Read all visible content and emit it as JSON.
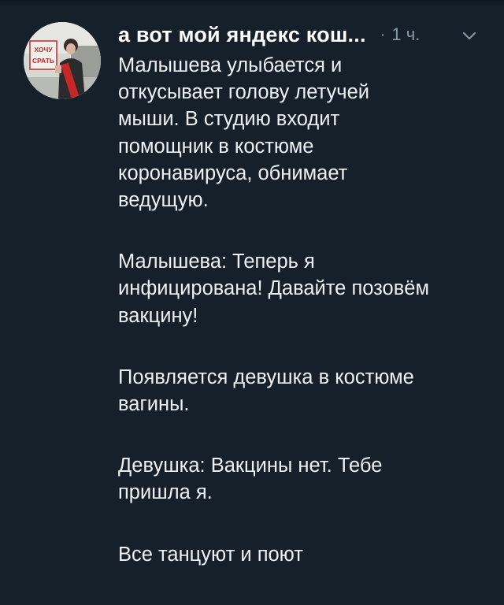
{
  "tweet": {
    "author": "а вот мой яндекс кош...",
    "separator": "·",
    "time": "1 ч.",
    "avatar_sign_text": "ХОЧУ СРАТЬ",
    "paragraphs": [
      "Малышева улыбается и откусывает голову летучей мыши. В студию входит помощник в костюме коронавируса, обнимает ведущую.",
      "Малышева: Теперь я инфицирована! Давайте позовём вакцину!",
      "Появляется девушка в костюме вагины.",
      "Девушка: Вакцины нет. Тебе пришла я.",
      "Все танцуют и поют"
    ]
  },
  "colors": {
    "background": "#15202b",
    "text": "#eef1f3",
    "muted": "#8899a6"
  },
  "icons": {
    "menu": "chevron-down-icon"
  }
}
